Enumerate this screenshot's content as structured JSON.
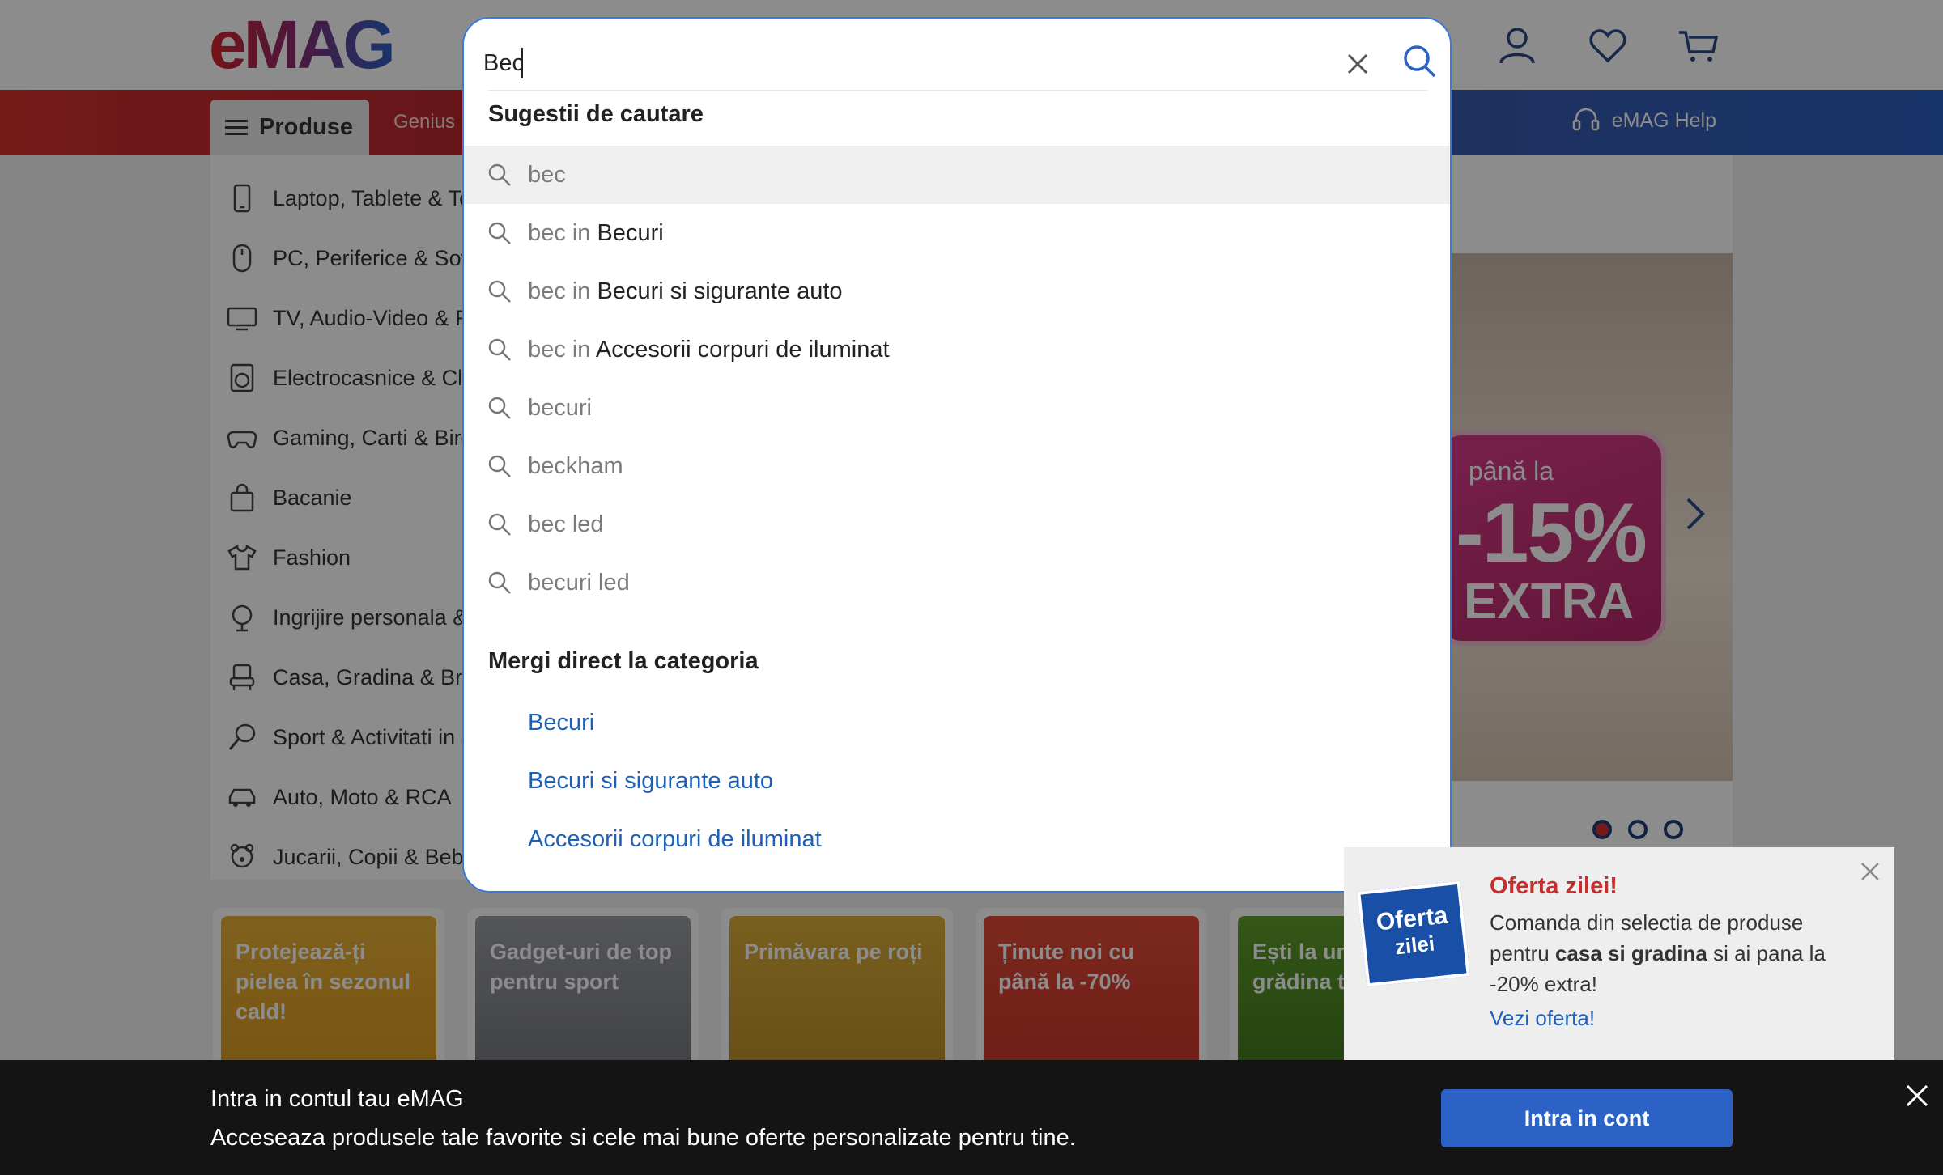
{
  "header": {
    "logo_text": "eMAG",
    "icons": [
      "user-icon",
      "heart-icon",
      "cart-icon"
    ]
  },
  "navbar": {
    "products_label": "Produse",
    "genius_label": "Genius",
    "help_label": "eMAG Help"
  },
  "sidebar": {
    "items": [
      {
        "label": "Laptop, Tablete & Telefoane",
        "icon": "phone-icon"
      },
      {
        "label": "PC, Periferice & Software",
        "icon": "mouse-icon"
      },
      {
        "label": "TV, Audio-Video & Foto",
        "icon": "tv-icon"
      },
      {
        "label": "Electrocasnice & Climatizare",
        "icon": "washer-icon"
      },
      {
        "label": "Gaming, Carti & Birotica",
        "icon": "gamepad-icon"
      },
      {
        "label": "Bacanie",
        "icon": "bag-icon"
      },
      {
        "label": "Fashion",
        "icon": "shirt-icon"
      },
      {
        "label": "Ingrijire personala & Cosmetice",
        "icon": "care-icon"
      },
      {
        "label": "Casa, Gradina & Bricolaj",
        "icon": "chair-icon"
      },
      {
        "label": "Sport & Activitati in aer liber",
        "icon": "racket-icon"
      },
      {
        "label": "Auto, Moto & RCA",
        "icon": "car-icon"
      },
      {
        "label": "Jucarii, Copii & Bebe",
        "icon": "teddy-icon"
      }
    ]
  },
  "hero": {
    "promo_top": "până la",
    "promo_percent": "-15%",
    "promo_bottom": "EXTRA",
    "slides_total": 3,
    "slide_active": 1
  },
  "tiles": [
    {
      "text": "Protejează-ți pielea în sezonul cald!",
      "color": "#e0a21c"
    },
    {
      "text": "Gadget-uri de top pentru sport",
      "color": "#7d7f86"
    },
    {
      "text": "Primăvara pe roți",
      "color": "#cf9e2a"
    },
    {
      "text": "Ținute noi cu până la -70%",
      "color": "#d63a2c"
    },
    {
      "text": "Ești la un click de grădina ta de vis!",
      "color": "#4f8a1f"
    }
  ],
  "search": {
    "query": "Bec",
    "suggestions_title": "Sugestii de cautare",
    "in_word": "in",
    "suggestions": [
      {
        "query": "bec",
        "category": ""
      },
      {
        "query": "bec",
        "category": "Becuri"
      },
      {
        "query": "bec",
        "category": "Becuri si sigurante auto"
      },
      {
        "query": "bec",
        "category": "Accesorii corpuri de iluminat"
      },
      {
        "query": "becuri",
        "category": ""
      },
      {
        "query": "beckham",
        "category": ""
      },
      {
        "query": "bec led",
        "category": ""
      },
      {
        "query": "becuri led",
        "category": ""
      }
    ],
    "categories_title": "Mergi direct la categoria",
    "categories": [
      "Becuri",
      "Becuri si sigurante auto",
      "Accesorii corpuri de iluminat"
    ]
  },
  "oferta": {
    "badge_line1": "Oferta",
    "badge_line2": "zilei",
    "title": "Oferta zilei!",
    "body_pre": "Comanda din selectia de produse pentru ",
    "body_bold": "casa si gradina",
    "body_post": " si ai pana la -20% extra!",
    "link": "Vezi oferta!"
  },
  "banner": {
    "title": "Intra in contul tau eMAG",
    "subtitle": "Acceseaza produsele tale favorite si cele mai bune oferte personalizate pentru tine.",
    "button": "Intra in cont"
  },
  "colors": {
    "accent_blue": "#1e5fb8",
    "brand_red": "#d4302f",
    "offer_red": "#c62d2d"
  }
}
